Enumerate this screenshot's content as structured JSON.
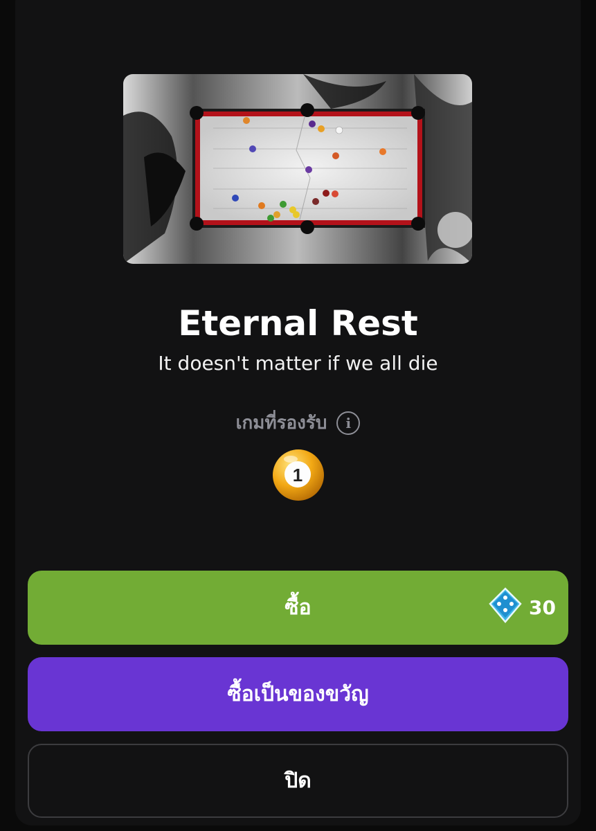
{
  "item": {
    "title": "Eternal Rest",
    "subtitle": "It doesn't matter if we all die"
  },
  "supported_games": {
    "label": "เกมที่รองรับ",
    "info_icon": "info-icon",
    "games": [
      {
        "icon": "8ball-one-icon",
        "number": "1"
      }
    ]
  },
  "buttons": {
    "buy_label": "ซื้อ",
    "buy_price": "30",
    "buy_currency_icon": "dice-gem-icon",
    "gift_label": "ซื้อเป็นของขวัญ",
    "close_label": "ปิด"
  },
  "colors": {
    "buy": "#72ac35",
    "gift": "#6935d3",
    "panel": "#121213"
  }
}
